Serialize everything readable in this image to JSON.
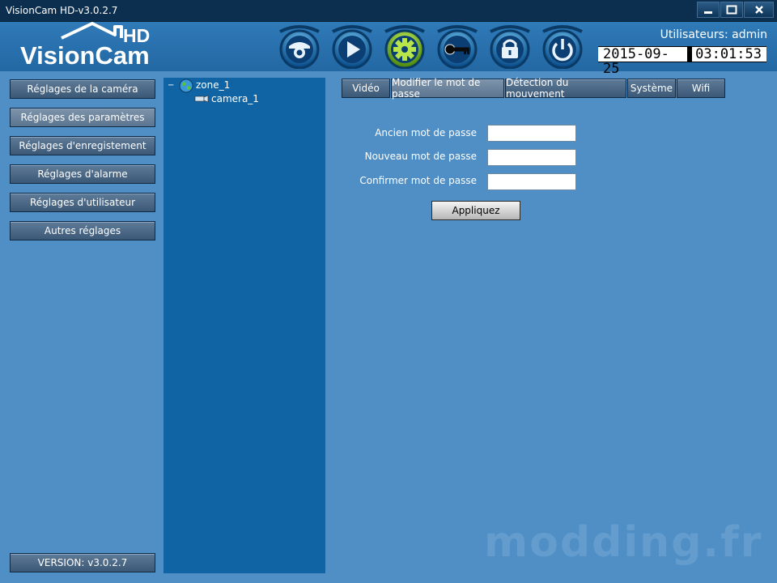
{
  "window": {
    "title": "VisionCam HD-v3.0.2.7"
  },
  "header": {
    "logo_text": "VisionCam",
    "logo_badge": "HD",
    "users_label": "Utilisateurs: admin",
    "date": "2015-09-25",
    "time": "03:01:53",
    "nav_icons": [
      "camera-icon",
      "play-icon",
      "settings-gear-icon",
      "key-icon",
      "lock-icon",
      "power-icon"
    ]
  },
  "sidebar": {
    "items": [
      "Réglages de la caméra",
      "Réglages des paramètres",
      "Réglages d'enregistement",
      "Réglages d'alarme",
      "Réglages d'utilisateur",
      "Autres réglages"
    ],
    "version": "VERSION: v3.0.2.7"
  },
  "tree": {
    "zone": "zone_1",
    "camera": "camera_1"
  },
  "tabs": [
    "Vidéo",
    "Modifier le mot de passe",
    "Détection du mouvement",
    "Système",
    "Wifi"
  ],
  "form": {
    "old_password": "Ancien mot de passe",
    "new_password": "Nouveau mot de passe",
    "confirm_password": "Confirmer mot de passe",
    "apply": "Appliquez"
  },
  "watermark": "modding.fr",
  "colors": {
    "accent": "#1064a4",
    "background": "#4f8fc6",
    "active_nav": "#7fc12a"
  }
}
